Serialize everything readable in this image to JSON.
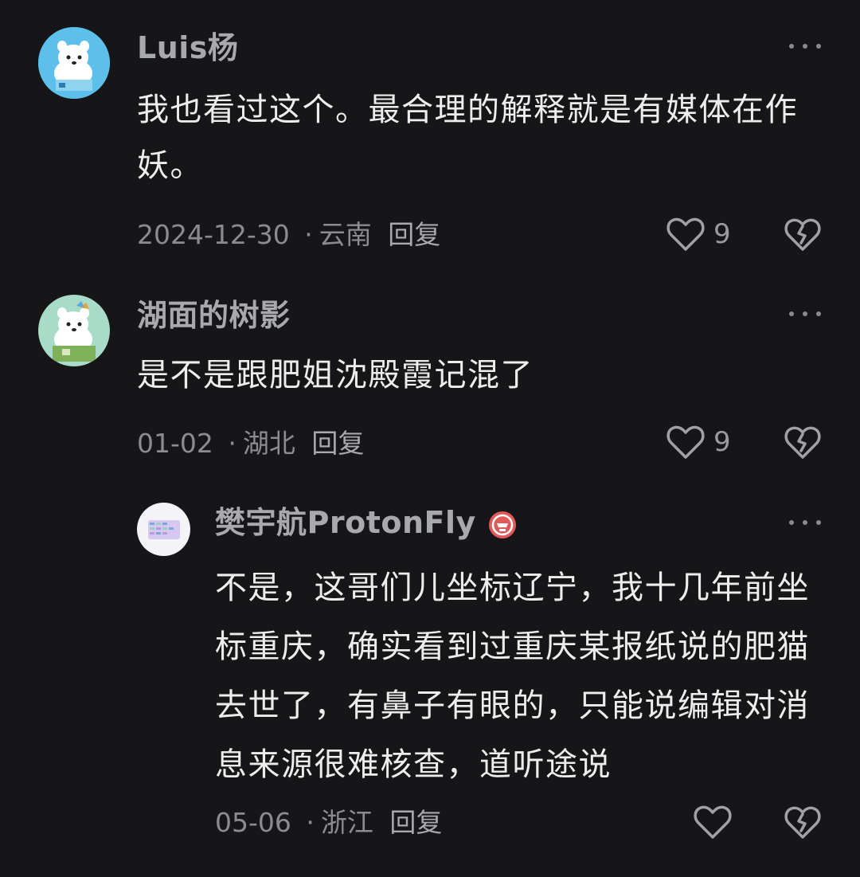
{
  "comments": [
    {
      "username": "Luis杨",
      "content": "我也看过这个。最合理的解释就是有媒体在作妖。",
      "date": "2024-12-30",
      "separator": "·",
      "location": "云南",
      "reply_label": "回复",
      "likes": "9"
    },
    {
      "username": "湖面的树影",
      "content": "是不是跟肥姐沈殿霞记混了",
      "date": "01-02",
      "separator": "·",
      "location": "湖北",
      "reply_label": "回复",
      "likes": "9"
    },
    {
      "username": "樊宇航ProtonFly",
      "content": "不是，这哥们儿坐标辽宁，我十几年前坐标重庆，确实看到过重庆某报纸说的肥猫去世了，有鼻子有眼的，只能说编辑对消息来源很难核查，道听途说",
      "date": "05-06",
      "separator": "·",
      "location": "浙江",
      "reply_label": "回复",
      "likes": ""
    }
  ],
  "colors": {
    "background": "#161618",
    "username": "#a7a9ad",
    "text": "#ededed",
    "meta": "#8b8c90",
    "badge": "#e05a5a"
  },
  "icons": {
    "more": "more-dots-icon",
    "like": "heart-outline-icon",
    "dislike": "broken-heart-icon",
    "badge": "verified-badge-icon"
  }
}
